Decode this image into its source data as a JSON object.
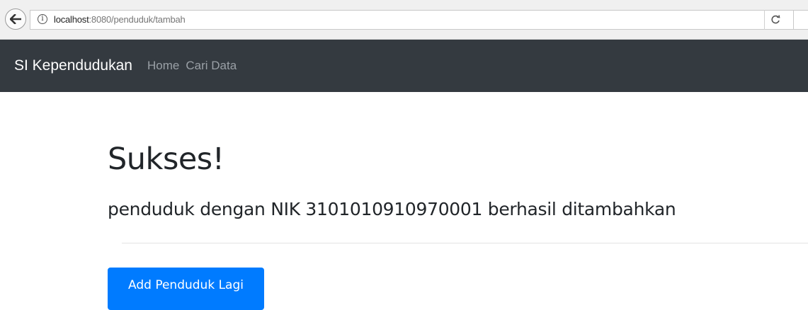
{
  "browser": {
    "url_host": "localhost",
    "url_path": ":8080/penduduk/tambah",
    "reload_icon": "reload-icon",
    "back_icon": "back-arrow-icon",
    "info_icon": "info-icon"
  },
  "navbar": {
    "brand": "SI Kependudukan",
    "links": [
      "Home",
      "Cari Data"
    ],
    "background": "#343a40"
  },
  "main": {
    "title": "Sukses!",
    "message": "penduduk dengan NIK 3101010910970001 berhasil ditambahkan",
    "button_label": "Add Penduduk Lagi",
    "button_color": "#007bff"
  }
}
